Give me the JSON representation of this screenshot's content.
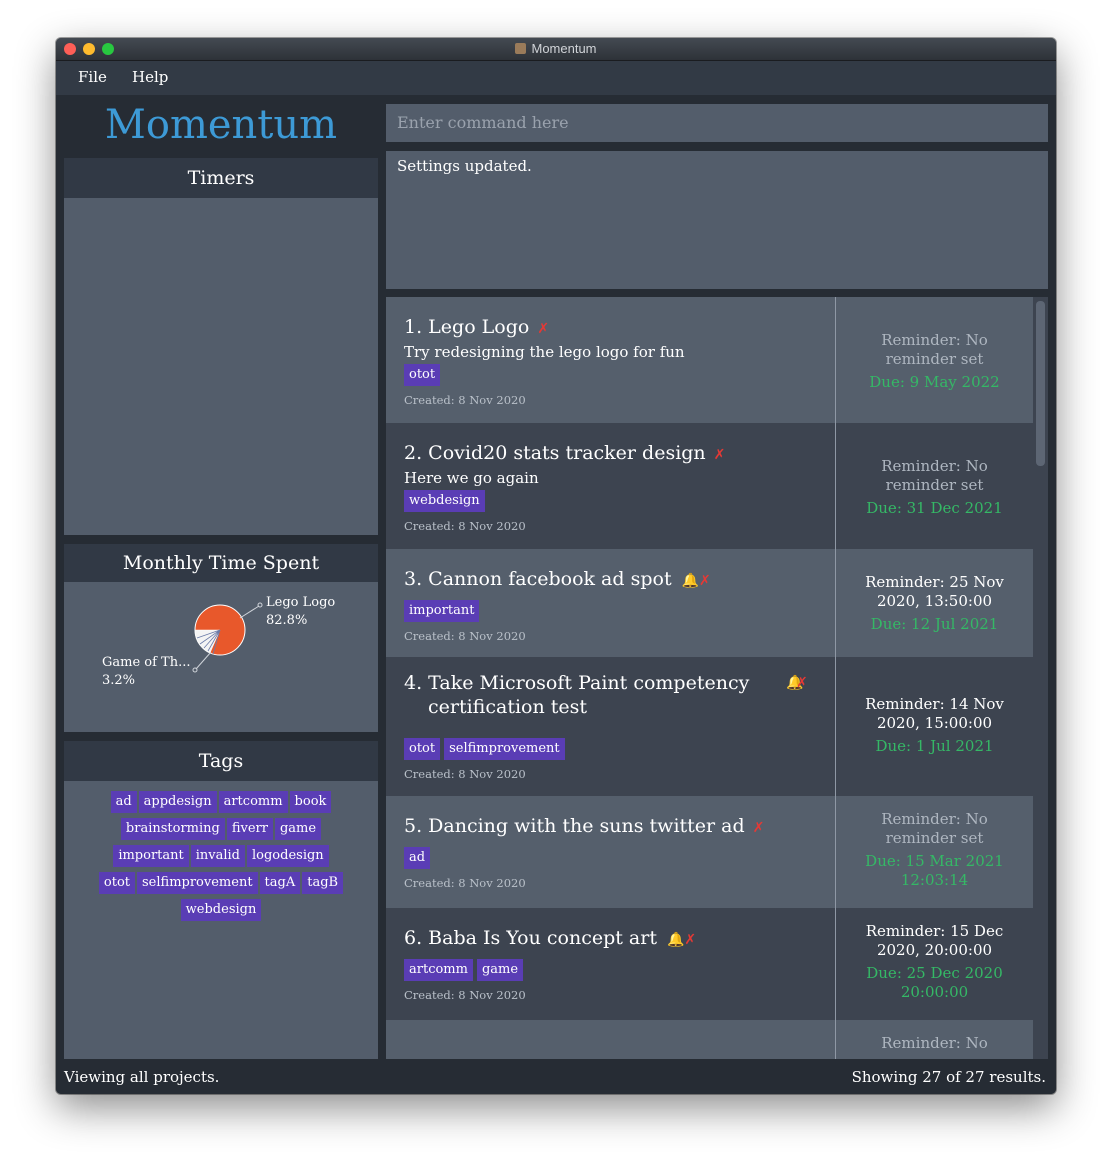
{
  "window": {
    "title": "Momentum"
  },
  "menu": {
    "file": "File",
    "help": "Help"
  },
  "sidebar": {
    "brand": "Momentum",
    "timers_title": "Timers",
    "monthly_title": "Monthly Time Spent",
    "tags_title": "Tags",
    "pie": {
      "slices": [
        {
          "label": "Lego Logo",
          "percent": "82.8%",
          "color": "#e8582b"
        },
        {
          "label": "Game of Th...",
          "percent": "3.2%",
          "color": "#ffffff"
        }
      ]
    },
    "tags": [
      [
        "ad",
        "appdesign",
        "artcomm",
        "book"
      ],
      [
        "brainstorming",
        "fiverr",
        "game"
      ],
      [
        "important",
        "invalid",
        "logodesign"
      ],
      [
        "otot",
        "selfimprovement",
        "tagA",
        "tagB"
      ],
      [
        "webdesign"
      ]
    ]
  },
  "command": {
    "placeholder": "Enter command here"
  },
  "result": {
    "text": "Settings updated."
  },
  "projects": [
    {
      "title": "1. Lego Logo",
      "desc": "Try redesigning the lego logo for fun",
      "tags": [
        "otot"
      ],
      "created": "Created: 8 Nov 2020",
      "bell": false,
      "reminder": [
        "Reminder: No",
        "reminder set"
      ],
      "reminder_set": false,
      "due": [
        "Due: 9 May 2022"
      ]
    },
    {
      "title": "2. Covid20 stats tracker design",
      "desc": "Here we go again",
      "tags": [
        "webdesign"
      ],
      "created": "Created: 8 Nov 2020",
      "bell": false,
      "reminder": [
        "Reminder: No",
        "reminder set"
      ],
      "reminder_set": false,
      "due": [
        "Due: 31 Dec 2021"
      ]
    },
    {
      "title": "3. Cannon facebook ad spot",
      "desc": "",
      "tags": [
        "important"
      ],
      "created": "Created: 8 Nov 2020",
      "bell": true,
      "reminder": [
        "Reminder: 25 Nov",
        "2020, 13:50:00"
      ],
      "reminder_set": true,
      "due": [
        "Due: 12 Jul 2021"
      ]
    },
    {
      "title": "4. Take Microsoft Paint competency certification test",
      "desc": "",
      "tags": [
        "otot",
        "selfimprovement"
      ],
      "created": "Created: 8 Nov 2020",
      "bell": true,
      "reminder": [
        "Reminder: 14 Nov",
        "2020, 15:00:00"
      ],
      "reminder_set": true,
      "due": [
        "Due: 1 Jul 2021"
      ]
    },
    {
      "title": "5. Dancing with the suns twitter ad",
      "desc": "",
      "tags": [
        "ad"
      ],
      "created": "Created: 8 Nov 2020",
      "bell": false,
      "reminder": [
        "Reminder: No",
        "reminder set"
      ],
      "reminder_set": false,
      "due": [
        "Due: 15 Mar 2021",
        "12:03:14"
      ]
    },
    {
      "title": "6. Baba Is You concept art",
      "desc": "",
      "tags": [
        "artcomm",
        "game"
      ],
      "created": "Created: 8 Nov 2020",
      "bell": true,
      "reminder": [
        "Reminder: 15 Dec",
        "2020, 20:00:00"
      ],
      "reminder_set": true,
      "due": [
        "Due: 25 Dec 2020",
        "20:00:00"
      ]
    },
    {
      "title": "",
      "desc": "",
      "tags": [],
      "created": "",
      "bell": false,
      "reminder": [
        "Reminder: No"
      ],
      "reminder_set": false,
      "due": []
    }
  ],
  "status": {
    "left": "Viewing all projects.",
    "right": "Showing 27 of 27 results."
  },
  "colors": {
    "accent": "#3d9ad6",
    "tag": "#5a3db5",
    "due": "#35b866",
    "delete": "#e53935"
  }
}
